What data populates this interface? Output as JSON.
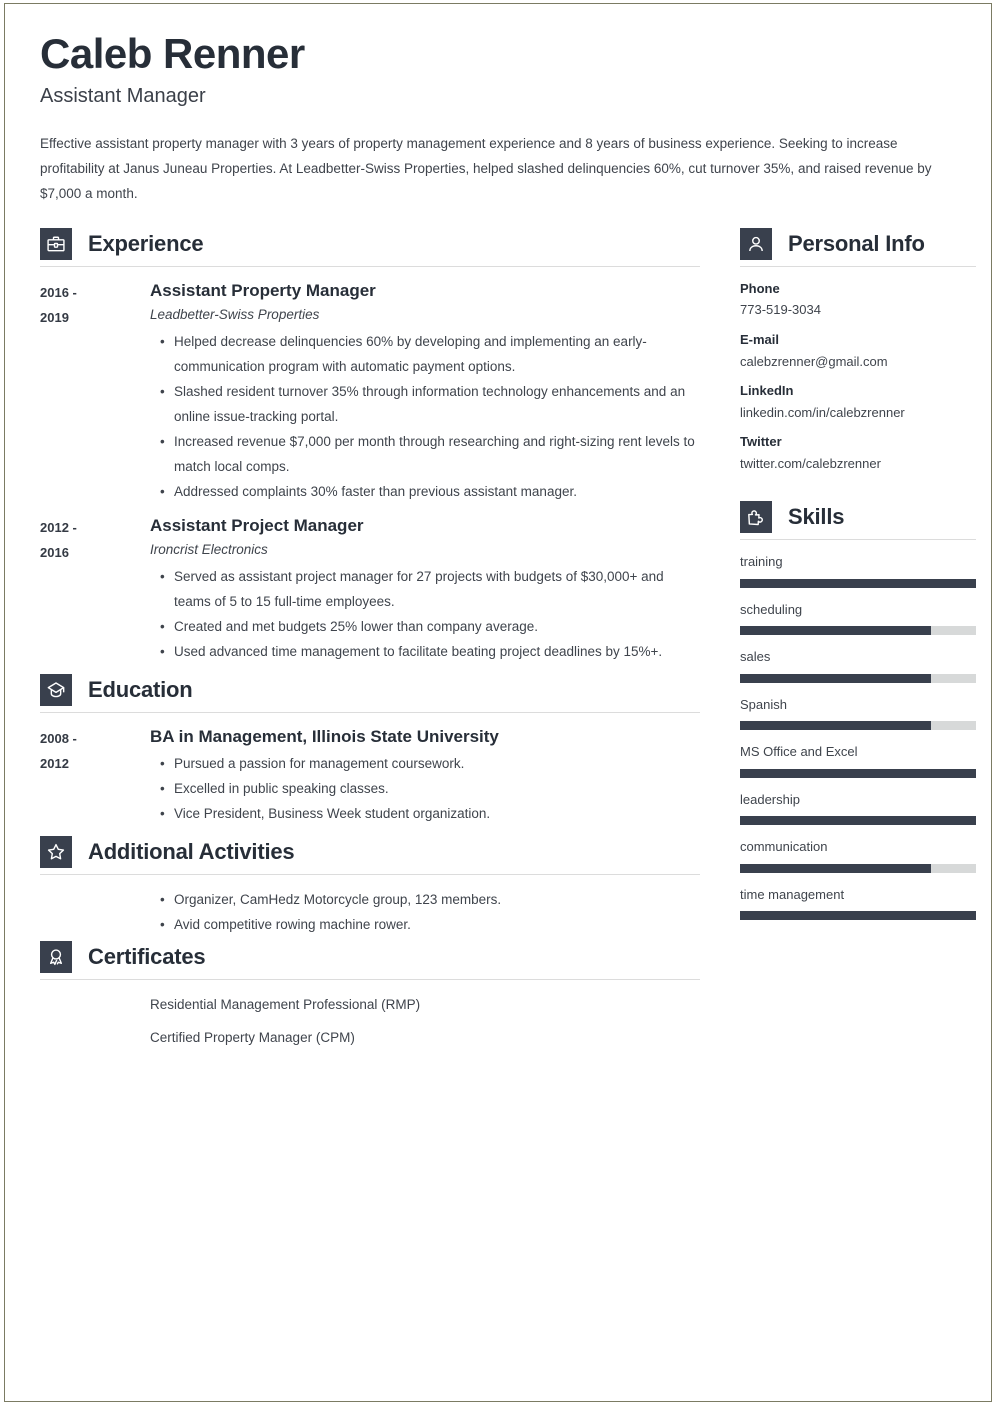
{
  "header": {
    "name": "Caleb Renner",
    "job_title": "Assistant Manager",
    "summary": "Effective assistant property manager with 3 years of property management experience and 8 years of business experience. Seeking to increase profitability at Janus Juneau Properties. At Leadbetter-Swiss Properties, helped slashed delinquencies 60%, cut turnover 35%, and raised revenue by $7,000 a month."
  },
  "theme": {
    "icon_background": "#39404d",
    "heading_color": "#272e38",
    "text_color": "#3f444c",
    "rule_color": "#dcdcdc",
    "skill_track_color": "#d7d9d9",
    "skill_fill_color": "#39404d",
    "page_border_color": "#7b7b63"
  },
  "sections": {
    "experience": {
      "title": "Experience",
      "icon": "briefcase-icon",
      "entries": [
        {
          "dates": "2016 - 2019",
          "date_line_1": "2016 -",
          "date_line_2": "2019",
          "role": "Assistant Property Manager",
          "organization": "Leadbetter-Swiss Properties",
          "bullets": [
            "Helped decrease delinquencies 60% by developing and implementing an early-communication program with automatic payment options.",
            "Slashed resident turnover 35% through information technology enhancements and an online issue-tracking portal.",
            "Increased revenue $7,000 per month through researching and right-sizing rent levels to match local comps.",
            "Addressed complaints 30% faster than previous assistant manager."
          ]
        },
        {
          "dates": "2012 - 2016",
          "date_line_1": "2012 -",
          "date_line_2": "2016",
          "role": "Assistant Project Manager",
          "organization": "Ironcrist Electronics",
          "bullets": [
            "Served as assistant project manager for 27 projects with budgets of $30,000+ and teams of 5 to 15 full-time employees.",
            "Created and met budgets 25% lower than company average.",
            "Used advanced time management to facilitate beating project deadlines by 15%+."
          ]
        }
      ]
    },
    "education": {
      "title": "Education",
      "icon": "graduation-cap-icon",
      "entries": [
        {
          "dates": "2008 - 2012",
          "date_line_1": "2008 -",
          "date_line_2": "2012",
          "degree": "BA in Management, Illinois State University",
          "bullets": [
            "Pursued a passion for management coursework.",
            "Excelled in public speaking classes.",
            "Vice President, Business Week student organization."
          ]
        }
      ]
    },
    "additional_activities": {
      "title": "Additional Activities",
      "icon": "star-icon",
      "bullets": [
        "Organizer, CamHedz Motorcycle group, 123 members.",
        "Avid competitive rowing machine rower."
      ]
    },
    "certificates": {
      "title": "Certificates",
      "icon": "award-ribbon-icon",
      "items": [
        "Residential Management Professional (RMP)",
        "Certified Property Manager (CPM)"
      ]
    },
    "personal_info": {
      "title": "Personal Info",
      "icon": "person-icon",
      "fields": [
        {
          "label": "Phone",
          "value": "773-519-3034"
        },
        {
          "label": "E-mail",
          "value": "calebzrenner@gmail.com"
        },
        {
          "label": "LinkedIn",
          "value": "linkedin.com/in/calebzrenner"
        },
        {
          "label": "Twitter",
          "value": "twitter.com/calebzrenner"
        }
      ]
    },
    "skills": {
      "title": "Skills",
      "icon": "puzzle-piece-icon",
      "items": [
        {
          "name": "training",
          "level": 100
        },
        {
          "name": "scheduling",
          "level": 81
        },
        {
          "name": "sales",
          "level": 81
        },
        {
          "name": "Spanish",
          "level": 81
        },
        {
          "name": "MS Office and Excel",
          "level": 100
        },
        {
          "name": "leadership",
          "level": 100
        },
        {
          "name": "communication",
          "level": 81
        },
        {
          "name": "time management",
          "level": 100
        }
      ]
    }
  }
}
